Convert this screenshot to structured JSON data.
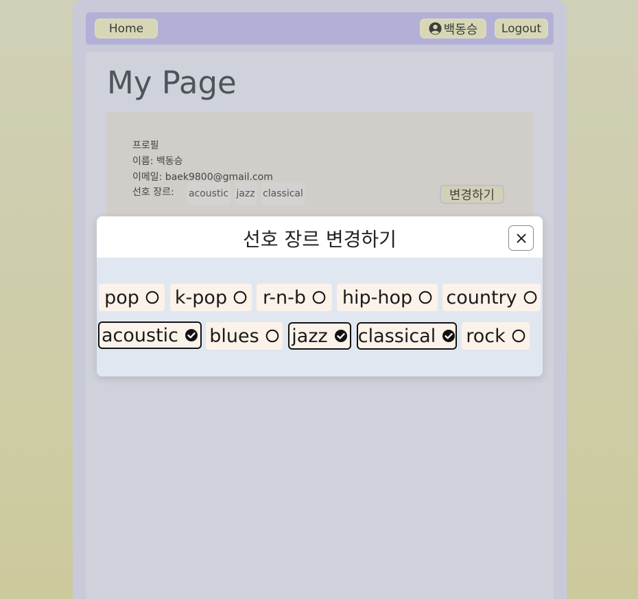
{
  "navbar": {
    "home_label": "Home",
    "user_name": "백동승",
    "logout_label": "Logout"
  },
  "page": {
    "title": "My Page"
  },
  "profile": {
    "heading": "프로필",
    "name_line": "이름: 백동승",
    "email_line": "이메일: baek9800@gmail.com",
    "genres_label": "선호 장르:",
    "genres": [
      "acoustic",
      "jazz",
      "classical"
    ],
    "edit_label": "변경하기"
  },
  "modal": {
    "title": "선호 장르 변경하기",
    "close_label": "×",
    "genres": [
      {
        "label": "pop",
        "selected": false
      },
      {
        "label": "k-pop",
        "selected": false
      },
      {
        "label": "r-n-b",
        "selected": false
      },
      {
        "label": "hip-hop",
        "selected": false
      },
      {
        "label": "country",
        "selected": false
      },
      {
        "label": "acoustic",
        "selected": true
      },
      {
        "label": "blues",
        "selected": false
      },
      {
        "label": "jazz",
        "selected": true
      },
      {
        "label": "classical",
        "selected": true
      },
      {
        "label": "rock",
        "selected": false
      }
    ]
  },
  "icons": {
    "user": "user-circle-icon",
    "close": "close-icon",
    "unchecked": "circle-outline-icon",
    "checked": "check-circle-icon"
  },
  "colors": {
    "navbar": "#b3b0d8",
    "nav_button": "#d7d7b6",
    "page": "#cfd2da",
    "profile_card": "#d1cdc8",
    "modal_body": "#e1e7f0",
    "chip": "#fbf2e9"
  }
}
